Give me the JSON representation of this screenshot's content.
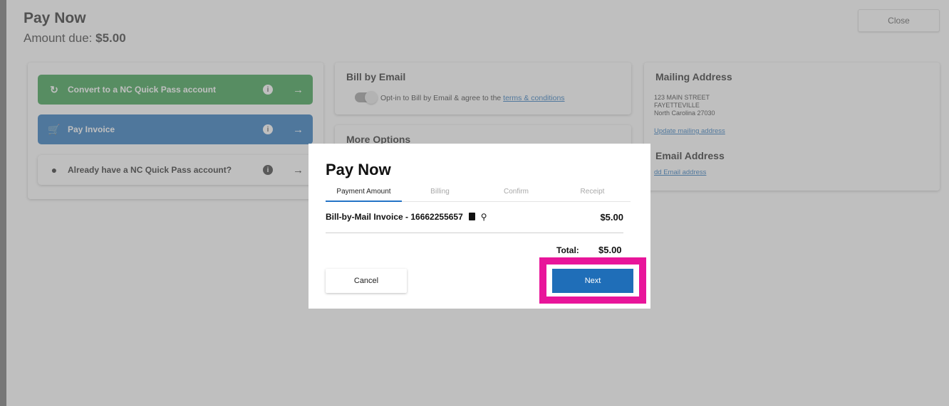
{
  "page": {
    "title": "Pay Now",
    "amount_prefix": "Amount due: ",
    "amount": "$5.00",
    "close_label": "Close"
  },
  "actions": [
    {
      "label": "Convert to a NC Quick Pass account",
      "icon": "refresh-icon"
    },
    {
      "label": "Pay Invoice",
      "icon": "cart-icon"
    },
    {
      "label": "Already have a NC Quick Pass account?",
      "icon": "user-icon"
    }
  ],
  "bill_by_email": {
    "heading": "Bill by Email",
    "optin_text": "Opt-in to Bill by Email & agree to the ",
    "terms_link": "terms & conditions"
  },
  "more_options": {
    "heading": "More Options"
  },
  "mailing": {
    "heading": "Mailing Address",
    "line1": "123 MAIN STREET",
    "line2": "FAYETTEVILLE",
    "line3": "North Carolina 27030",
    "update_link": "Update mailing address",
    "email_heading": "Email Address",
    "email_link": "dd Email address"
  },
  "modal": {
    "title": "Pay Now",
    "steps": [
      "Payment Amount",
      "Billing",
      "Confirm",
      "Receipt"
    ],
    "active_step": 0,
    "invoice_label": "Bill-by-Mail Invoice - 16662255657",
    "invoice_amount": "$5.00",
    "total_label": "Total:",
    "total_value": "$5.00",
    "cancel_label": "Cancel",
    "next_label": "Next"
  },
  "colors": {
    "green": "#2e9a44",
    "blue": "#1f6eb8",
    "highlight": "#e8159a"
  }
}
